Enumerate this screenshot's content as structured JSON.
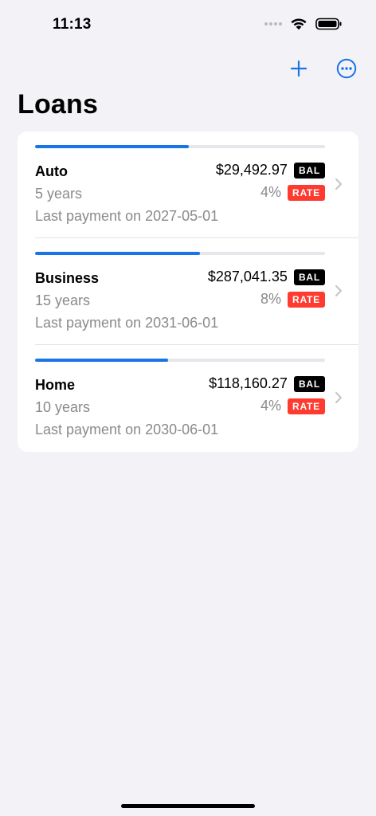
{
  "status_bar": {
    "time": "11:13"
  },
  "nav": {
    "add_icon": "plus-icon",
    "more_icon": "ellipsis-circle-icon",
    "accent_color": "#1a73e8"
  },
  "page": {
    "title": "Loans"
  },
  "badges": {
    "balance": "BAL",
    "rate": "RATE"
  },
  "loans": [
    {
      "name": "Auto",
      "balance": "$29,492.97",
      "term": "5 years",
      "rate": "4%",
      "last_payment": "Last payment on 2027-05-01",
      "progress": 0.53
    },
    {
      "name": "Business",
      "balance": "$287,041.35",
      "term": "15 years",
      "rate": "8%",
      "last_payment": "Last payment on 2031-06-01",
      "progress": 0.57
    },
    {
      "name": "Home",
      "balance": "$118,160.27",
      "term": "10 years",
      "rate": "4%",
      "last_payment": "Last payment on 2030-06-01",
      "progress": 0.46
    }
  ]
}
